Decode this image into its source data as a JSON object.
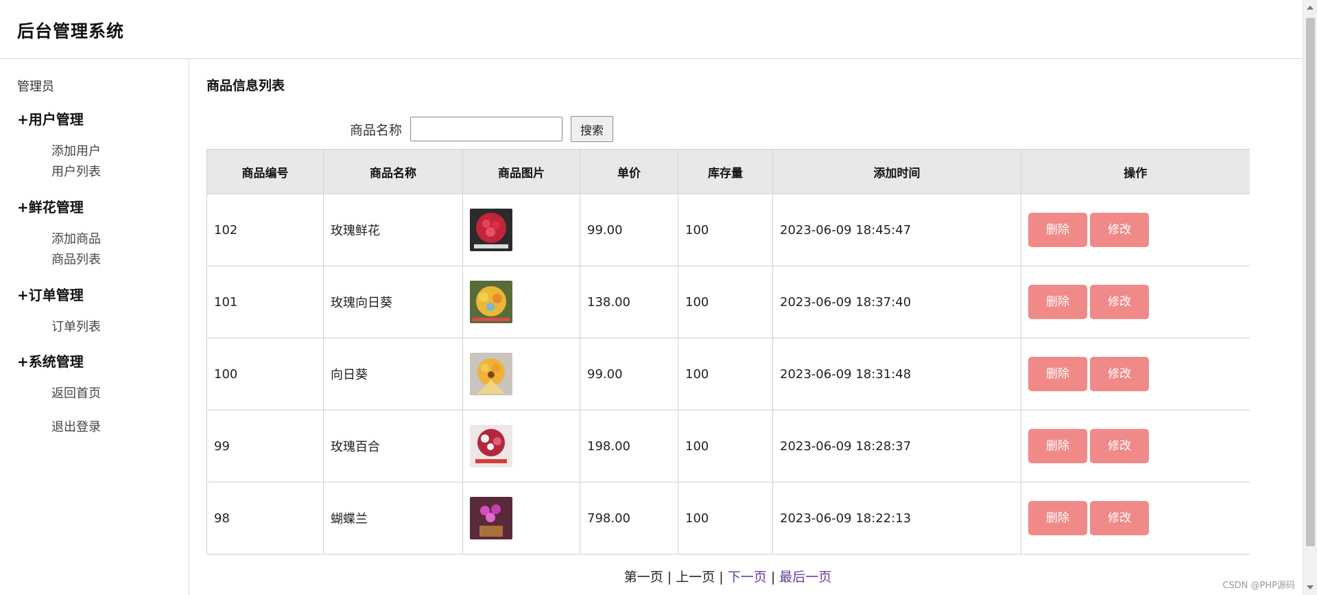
{
  "app": {
    "title": "后台管理系统"
  },
  "sidebar": {
    "role": "管理员",
    "groups": [
      {
        "title": "+用户管理",
        "items": [
          "添加用户",
          "用户列表"
        ]
      },
      {
        "title": "+鲜花管理",
        "items": [
          "添加商品",
          "商品列表"
        ]
      },
      {
        "title": "+订单管理",
        "items": [
          "订单列表"
        ]
      },
      {
        "title": "+系统管理",
        "items": [
          "返回首页",
          "退出登录"
        ]
      }
    ]
  },
  "main": {
    "section_title": "商品信息列表",
    "search": {
      "label": "商品名称",
      "value": "",
      "button": "搜索"
    },
    "table": {
      "headers": [
        "商品编号",
        "商品名称",
        "商品图片",
        "单价",
        "库存量",
        "添加时间",
        "操作"
      ],
      "rows": [
        {
          "id": "102",
          "name": "玫瑰鲜花",
          "image": "red-rose-bouquet",
          "price": "99.00",
          "stock": "100",
          "time": "2023-06-09 18:45:47"
        },
        {
          "id": "101",
          "name": "玫瑰向日葵",
          "image": "rose-sunflower-bouquet",
          "price": "138.00",
          "stock": "100",
          "time": "2023-06-09 18:37:40"
        },
        {
          "id": "100",
          "name": "向日葵",
          "image": "sunflower-bouquet",
          "price": "99.00",
          "stock": "100",
          "time": "2023-06-09 18:31:48"
        },
        {
          "id": "99",
          "name": "玫瑰百合",
          "image": "rose-lily-bouquet",
          "price": "198.00",
          "stock": "100",
          "time": "2023-06-09 18:28:37"
        },
        {
          "id": "98",
          "name": "蝴蝶兰",
          "image": "phalaenopsis-orchid",
          "price": "798.00",
          "stock": "100",
          "time": "2023-06-09 18:22:13"
        }
      ],
      "actions": {
        "delete": "删除",
        "edit": "修改"
      }
    },
    "pagination": {
      "first": "第一页",
      "prev": "上一页",
      "next": "下一页",
      "last": "最后一页",
      "separator": "|"
    }
  },
  "watermark": "CSDN @PHP源码",
  "colors": {
    "action_button": "#f08a89",
    "active_link": "#6a3d98",
    "header_bg": "#e8e8e8"
  }
}
